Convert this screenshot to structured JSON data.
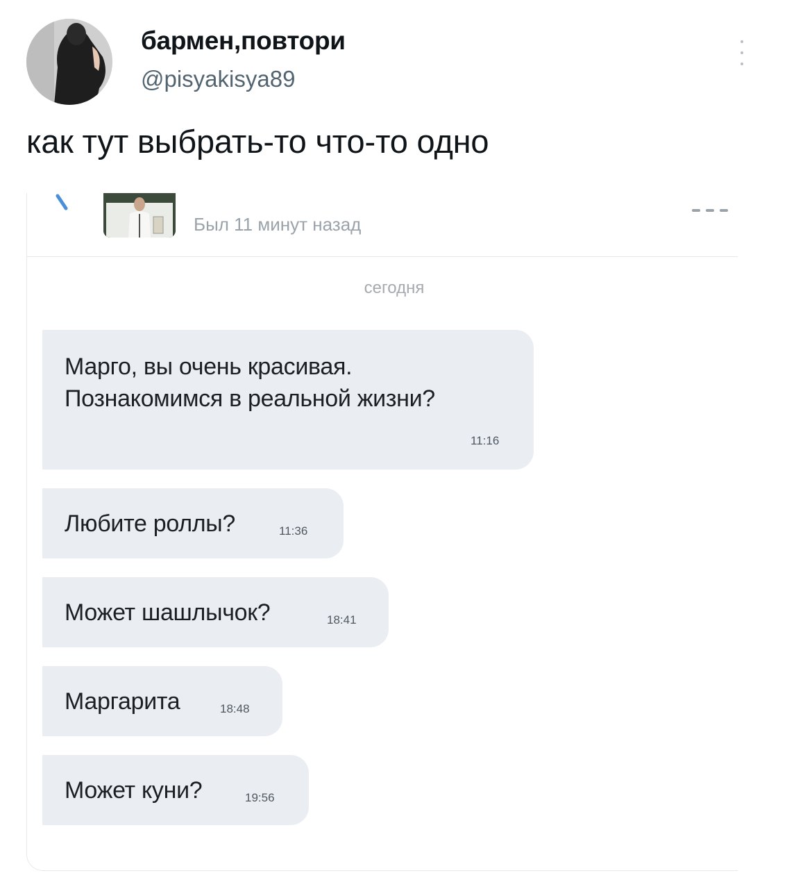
{
  "tweet": {
    "display_name": "бармен,повтори",
    "handle": "@pisyakisya89",
    "text": "как тут выбрать-то что-то одно"
  },
  "chat": {
    "status": "Был 11 минут назад",
    "date_label": "сегодня",
    "messages": [
      {
        "line1": "Марго, вы очень красивая.",
        "line2": "Познакомимся в реальной жизни?",
        "time": "11:16"
      },
      {
        "text": "Любите роллы?",
        "time": "11:36"
      },
      {
        "text": "Может шашлычок?",
        "time": "18:41"
      },
      {
        "text": "Маргарита",
        "time": "18:48"
      },
      {
        "text": "Может куни?",
        "time": "19:56"
      }
    ]
  },
  "colors": {
    "bubble": "#eaeef3",
    "handle": "#536471",
    "status": "#9aa2aa"
  },
  "icons": [
    "more-vertical-icon",
    "back-arrow-icon",
    "menu-dots-icon"
  ]
}
